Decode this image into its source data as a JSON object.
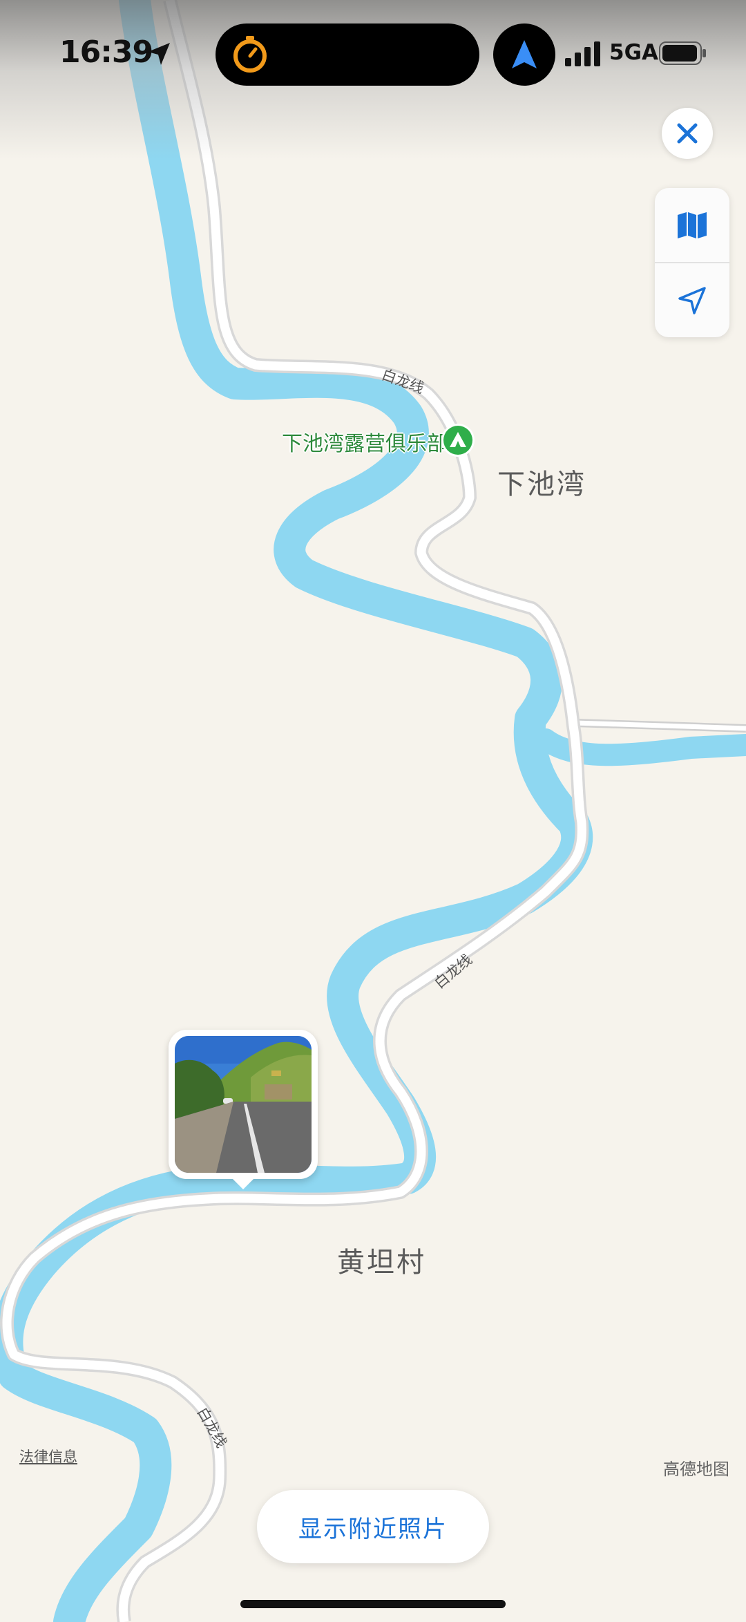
{
  "status_bar": {
    "time": "16:39",
    "network": "5GA",
    "icons": [
      "location-arrow-icon",
      "timer-icon",
      "navigation-arrow-icon",
      "signal-icon",
      "battery-icon"
    ]
  },
  "controls": {
    "close_icon": "close-icon",
    "map_mode_icon": "map-icon",
    "locate_icon": "location-arrow-icon"
  },
  "map": {
    "poi": {
      "name": "下池湾露营俱乐部",
      "icon": "campsite-icon",
      "color": "#2fae4a"
    },
    "places": [
      "下池湾",
      "黄坦村"
    ],
    "roads": [
      "白龙线",
      "白龙线",
      "白龙线"
    ],
    "river_color": "#8ed7f1",
    "road_color": "#ffffff",
    "land_color": "#f6f3ec"
  },
  "photo_pin": {
    "icon": "photo-thumbnail"
  },
  "footer": {
    "legal": "法律信息",
    "provider": "高德地图",
    "nearby_button": "显示附近照片"
  }
}
